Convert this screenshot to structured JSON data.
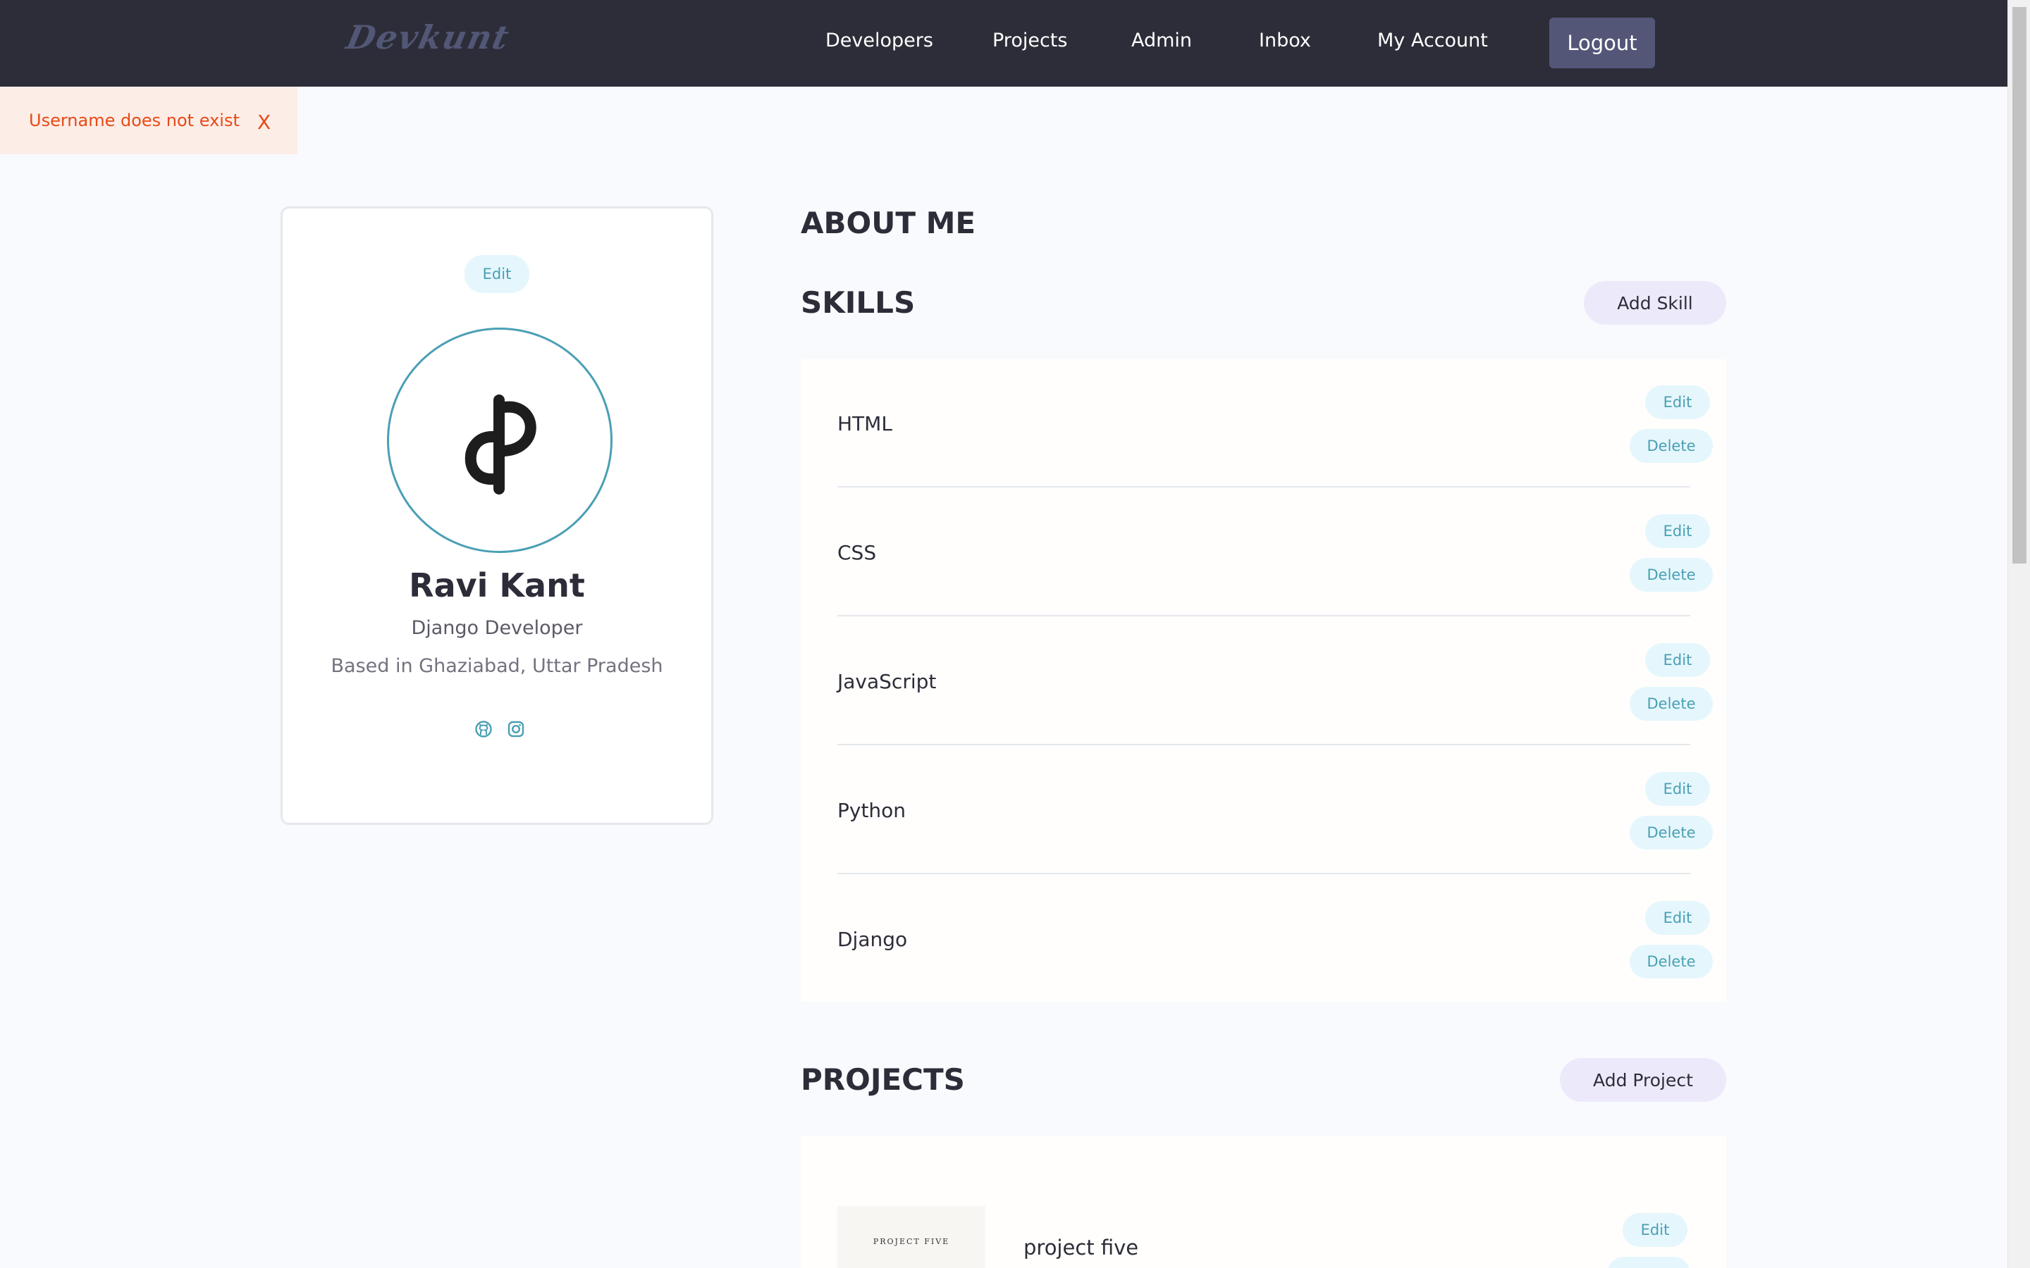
{
  "header": {
    "logo_text": "Devkunt",
    "nav": [
      "Developers",
      "Projects",
      "Admin",
      "Inbox",
      "My Account"
    ],
    "logout_label": "Logout"
  },
  "alert": {
    "message": "Username does not exist",
    "close_label": "X"
  },
  "profile": {
    "edit_label": "Edit",
    "name": "Ravi Kant",
    "title": "Django Developer",
    "location": "Based in Ghaziabad, Uttar Pradesh",
    "social_icons": [
      "github-icon",
      "instagram-icon"
    ]
  },
  "about": {
    "heading": "ABOUT ME"
  },
  "skills": {
    "heading": "SKILLS",
    "add_label": "Add Skill",
    "edit_label": "Edit",
    "delete_label": "Delete",
    "items": [
      "HTML",
      "CSS",
      "JavaScript",
      "Python",
      "Django"
    ]
  },
  "projects": {
    "heading": "PROJECTS",
    "add_label": "Add Project",
    "edit_label": "Edit",
    "items": [
      {
        "name": "project five",
        "thumb_text": "PROJECT FIVE"
      }
    ]
  },
  "colors": {
    "header_bg": "#2d2d39",
    "accent": "#4a9fb5",
    "alert_text": "#e74a17"
  }
}
